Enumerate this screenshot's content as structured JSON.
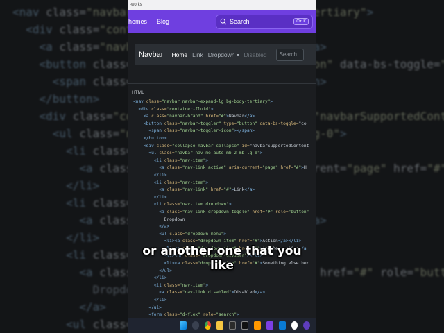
{
  "background_code": [
    "<nav class=\"navbar navbar-expand-lg bg-body-tertiary\">",
    "  <div class=\"container-fluid\">",
    "    <a class=\"navbar-brand\" href=\"#\">Navbar</a>",
    "    <button class=\"navbar-toggler\" type=\"button\" data-bs-toggle=\"collapse\"",
    "      <span class=\"navbar-toggler-icon\"></span>",
    "    </button>",
    "    <div class=\"collapse navbar-collapse\" id=\"navbarSupportedContent\">",
    "      <ul class=\"navbar-nav me-auto mb-2 mb-lg-0\">",
    "        <li class=\"nav-item\">",
    "          <a class=\"nav-link active\" aria-current=\"page\" href=\"#\">Home</a>",
    "        </li>",
    "        <li class=\"nav-item\">",
    "          <a class=\"nav-link\" href=\"#\">Link</a>",
    "        </li>",
    "        <li class=\"nav-item dropdown\">",
    "          <a class=\"nav-link dropdown-toggle\" href=\"#\" role=\"button\"",
    "            Dropdown",
    "          </a>",
    "        <ul class=\"dropdown-menu\">"
  ],
  "browser": {
    "url_fragment": "-works"
  },
  "site_nav": {
    "themes_label": "hemes",
    "blog_label": "Blog",
    "search_label": "Search",
    "search_shortcut": "Ctrl K"
  },
  "demo_navbar": {
    "brand": "Navbar",
    "home": "Home",
    "link": "Link",
    "dropdown": "Dropdown",
    "disabled": "Disabled",
    "search_placeholder": "Search"
  },
  "code_section_label": "HTML",
  "code_lines": [
    "<nav class=\"navbar navbar-expand-lg bg-body-tertiary\">",
    "  <div class=\"container-fluid\">",
    "    <a class=\"navbar-brand\" href=\"#\">Navbar</a>",
    "    <button class=\"navbar-toggler\" type=\"button\" data-bs-toggle=\"co",
    "      <span class=\"navbar-toggler-icon\"></span>",
    "    </button>",
    "    <div class=\"collapse navbar-collapse\" id=\"navbarSupportedContent",
    "      <ul class=\"navbar-nav me-auto mb-2 mb-lg-0\">",
    "        <li class=\"nav-item\">",
    "          <a class=\"nav-link active\" aria-current=\"page\" href=\"#\">H",
    "        </li>",
    "        <li class=\"nav-item\">",
    "          <a class=\"nav-link\" href=\"#\">Link</a>",
    "        </li>",
    "        <li class=\"nav-item dropdown\">",
    "          <a class=\"nav-link dropdown-toggle\" href=\"#\" role=\"button\"",
    "            Dropdown",
    "          </a>",
    "          <ul class=\"dropdown-menu\">",
    "            <li><a class=\"dropdown-item\" href=\"#\">Action</a></li>",
    "            <li><a class=\"dropdown-item\" href=\"#\">Another action</a",
    "            <li><hr class=\"dropdown-divider\"></li>",
    "            <li><a class=\"dropdown-item\" href=\"#\">Something else her",
    "          </ul>",
    "        </li>",
    "        <li class=\"nav-item\">",
    "          <a class=\"nav-link disabled\">Disabled</a>",
    "        </li>",
    "      </ul>",
    "      <form class=\"d-flex\" role=\"search\">"
  ],
  "caption": {
    "line1": "or another one that you",
    "line2": "like"
  },
  "taskbar": {
    "icons": [
      "windows-icon",
      "search-icon",
      "chrome-icon",
      "folder-icon",
      "store-icon",
      "terminal-icon",
      "sublime-icon",
      "app-icon",
      "vscode-icon",
      "github-icon",
      "obs-icon"
    ]
  },
  "colors": {
    "brand_purple": "#6f3fe0",
    "panel_bg": "#1b1d20",
    "demo_nav_bg": "#2b2f34"
  }
}
